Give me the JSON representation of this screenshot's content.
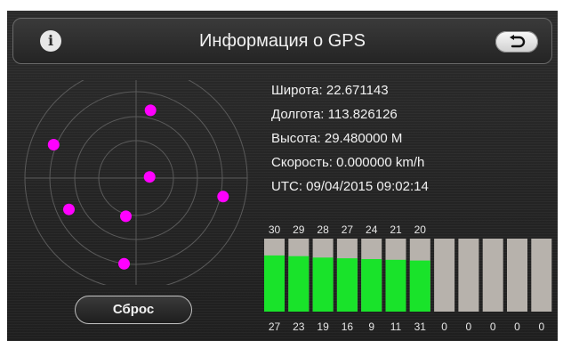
{
  "header": {
    "title": "Информация о GPS",
    "info_icon_glyph": "i",
    "info_icon": "info-icon",
    "back_icon": "return-arrow-icon"
  },
  "position": {
    "lines": [
      "Широта: 22.671143",
      "Долгота: 113.826126",
      "Высота: 29.480000 M",
      "Скорость: 0.000000 km/h",
      "UTC: 09/04/2015 09:02:14"
    ]
  },
  "satellites": {
    "ids": [
      "30",
      "29",
      "28",
      "27",
      "24",
      "21",
      "20",
      "",
      "",
      "",
      "",
      ""
    ],
    "snr": [
      "27",
      "23",
      "19",
      "16",
      "9",
      "11",
      "31",
      "0",
      "0",
      "0",
      "0",
      "0"
    ],
    "signal_fraction": [
      0.77,
      0.76,
      0.74,
      0.73,
      0.72,
      0.71,
      0.7,
      0,
      0,
      0,
      0,
      0
    ],
    "sky_positions": [
      {
        "azimuth_deg": 12,
        "elevation_deg": 34
      },
      {
        "azimuth_deg": 292,
        "elevation_deg": 18
      },
      {
        "azimuth_deg": 245,
        "elevation_deg": 30
      },
      {
        "azimuth_deg": 85,
        "elevation_deg": 79
      },
      {
        "azimuth_deg": 195,
        "elevation_deg": 58
      },
      {
        "azimuth_deg": 102,
        "elevation_deg": 18
      },
      {
        "azimuth_deg": 188,
        "elevation_deg": 20
      }
    ]
  },
  "colors": {
    "bar_background": "#b7b2ac",
    "signal": "#19e32a",
    "satellite_dot": "#ff00ff"
  },
  "footer": {
    "reset_label": "Сброс"
  }
}
